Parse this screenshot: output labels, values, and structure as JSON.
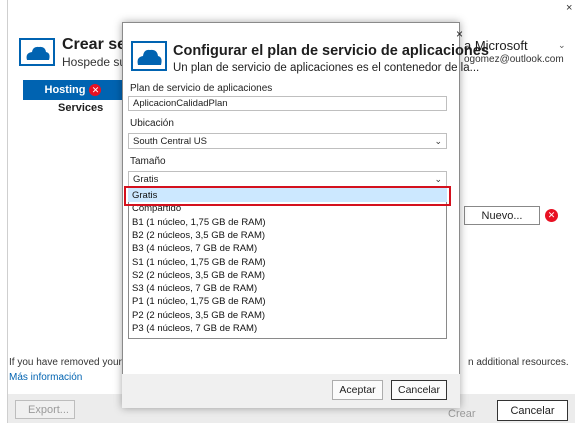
{
  "background": {
    "title": "Crear serv",
    "subtitle": "Hospede sus",
    "tabs": {
      "hosting": "Hosting",
      "services": "Services"
    },
    "account": {
      "name": "a Microsoft",
      "email": "ogomez@outlook.com"
    },
    "nuevo_label": "Nuevo...",
    "removed_text_left": "If you have removed your s",
    "removed_text_right": "n additional resources.",
    "more_info": "Más información",
    "export_label": "Export...",
    "create_label": "Crear",
    "cancel_label": "Cancelar",
    "close_glyph": "×"
  },
  "dialog": {
    "title": "Configurar el plan de servicio de aplicaciones",
    "subtitle": "Un plan de servicio de aplicaciones es el contenedor de la...",
    "close_glyph": "×",
    "plan_label": "Plan de servicio de aplicaciones",
    "plan_value": "AplicacionCalidadPlan",
    "location_label": "Ubicación",
    "location_value": "South Central US",
    "size_label": "Tamaño",
    "size_value": "Gratis",
    "size_options": [
      "Gratis",
      "Compartido",
      "B1 (1 núcleo, 1,75 GB de RAM)",
      "B2 (2 núcleos, 3,5 GB de RAM)",
      "B3 (4 núcleos, 7 GB de RAM)",
      "S1 (1 núcleo, 1,75 GB de RAM)",
      "S2 (2 núcleos, 3,5 GB de RAM)",
      "S3 (4 núcleos, 7 GB de RAM)",
      "P1 (1 núcleo, 1,75 GB de RAM)",
      "P2 (2 núcleos, 3,5 GB de RAM)",
      "P3 (4 núcleos, 7 GB de RAM)"
    ],
    "ok_label": "Aceptar",
    "cancel_label": "Cancelar"
  },
  "colors": {
    "accent": "#0063b1",
    "error": "#e81123",
    "highlight": "#d4111e",
    "selection": "#cce8ff"
  }
}
